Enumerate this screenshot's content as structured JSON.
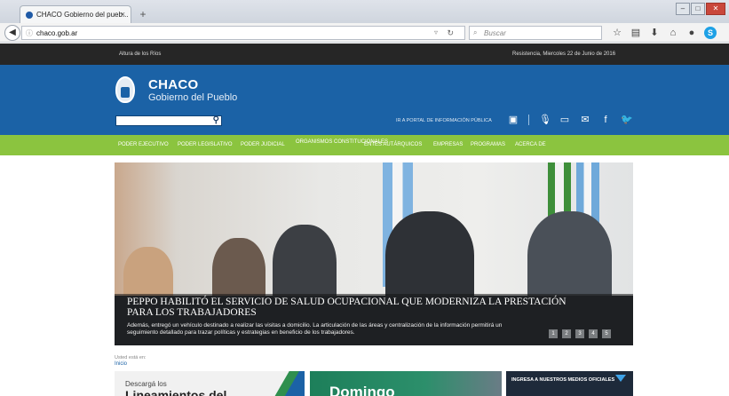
{
  "browser": {
    "tab_title": "CHACO Gobierno del pueb...",
    "tab_close": "×",
    "new_tab": "+",
    "url": "chaco.gob.ar",
    "search_placeholder": "Buscar"
  },
  "topstrip": {
    "left_text": "Altura de los Ríos",
    "right_text": "Resistencia, Miercoles 22 de Junio de 2016"
  },
  "header": {
    "brand": "CHACO",
    "subtitle": "Gobierno del Pueblo",
    "portal_link": "IR A PORTAL DE INFORMACIÓN PÚBLICA",
    "icons": [
      "contrast-icon",
      "microphone-icon",
      "monitor-icon",
      "mail-icon",
      "facebook-icon",
      "twitter-icon"
    ]
  },
  "menu": [
    "PODER EJECUTIVO",
    "PODER LEGISLATIVO",
    "PODER JUDICIAL",
    "ORGANISMOS CONSTITUCIONALES",
    "ENTES AUTÁRQUICOS",
    "EMPRESAS",
    "PROGRAMAS",
    "ACERCA DE"
  ],
  "hero": {
    "headline": "PEPPO HABILITÓ EL SERVICIO DE SALUD OCUPACIONAL QUE MODERNIZA LA PRESTACIÓN PARA LOS TRABAJADORES",
    "blurb": "Además, entregó un vehículo destinado a realizar las visitas a domicilio. La articulación de las áreas y centralización de la información permitirá un seguimiento detallado para trazar políticas y estrategias en beneficio de los trabajadores.",
    "pages": [
      "1",
      "2",
      "3",
      "4",
      "5"
    ]
  },
  "breadcrumb": {
    "label": "Usted está en:",
    "link": "Inicio"
  },
  "cards": {
    "card1_small": "Descargá los",
    "card1_big": "Lineamientos del",
    "card2_text": "Domingo",
    "card3_text": "INGRESA A NUESTROS MEDIOS OFICIALES"
  },
  "colors": {
    "header_blue": "#1b62a6",
    "menu_green": "#8bc43f",
    "top_dark": "#262626"
  }
}
